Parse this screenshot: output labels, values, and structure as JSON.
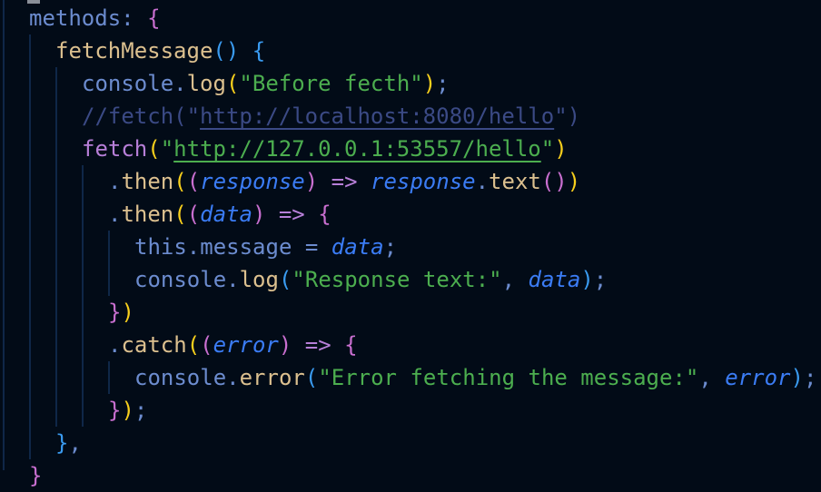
{
  "colors": {
    "background": "#020b17",
    "identifier": "#6c8ccf",
    "function": "#dcc08f",
    "string": "#4cae4f",
    "keyword": "#b77fd8",
    "bracket_yellow": "#f7cf1c",
    "bracket_pink": "#c96fd0",
    "bracket_blue": "#3a9bf0",
    "parameter": "#3b7cf5",
    "comment": "#3b4a85"
  },
  "lines": [
    {
      "indent": 2,
      "tokens": [
        {
          "t": "methods",
          "k": "ident"
        },
        {
          "t": ": ",
          "k": "punct"
        },
        {
          "t": "{",
          "k": "p2"
        }
      ]
    },
    {
      "indent": 4,
      "tokens": [
        {
          "t": "fetchMessage",
          "k": "fn"
        },
        {
          "t": "()",
          "k": "p3"
        },
        {
          "t": " ",
          "k": "punct"
        },
        {
          "t": "{",
          "k": "p3"
        }
      ]
    },
    {
      "indent": 6,
      "tokens": [
        {
          "t": "console",
          "k": "ident"
        },
        {
          "t": ".",
          "k": "punct"
        },
        {
          "t": "log",
          "k": "fn"
        },
        {
          "t": "(",
          "k": "p1"
        },
        {
          "t": "\"Before fecth\"",
          "k": "str"
        },
        {
          "t": ")",
          "k": "p1"
        },
        {
          "t": ";",
          "k": "punct"
        }
      ]
    },
    {
      "indent": 6,
      "tokens": [
        {
          "t": "//fetch(\"",
          "k": "comment"
        },
        {
          "t": "http://localhost:8080/hello",
          "k": "comment ul"
        },
        {
          "t": "\")",
          "k": "comment"
        }
      ]
    },
    {
      "indent": 6,
      "tokens": [
        {
          "t": "fetch",
          "k": "kw"
        },
        {
          "t": "(",
          "k": "p1"
        },
        {
          "t": "\"",
          "k": "str"
        },
        {
          "t": "http://127.0.0.1:53557/hello",
          "k": "str ul"
        },
        {
          "t": "\"",
          "k": "str"
        },
        {
          "t": ")",
          "k": "p1"
        }
      ]
    },
    {
      "indent": 8,
      "tokens": [
        {
          "t": ".",
          "k": "punct"
        },
        {
          "t": "then",
          "k": "fn"
        },
        {
          "t": "(",
          "k": "p1"
        },
        {
          "t": "(",
          "k": "p2"
        },
        {
          "t": "response",
          "k": "param"
        },
        {
          "t": ")",
          "k": "p2"
        },
        {
          "t": " => ",
          "k": "kw"
        },
        {
          "t": "response",
          "k": "param"
        },
        {
          "t": ".",
          "k": "punct"
        },
        {
          "t": "text",
          "k": "fn"
        },
        {
          "t": "()",
          "k": "p2"
        },
        {
          "t": ")",
          "k": "p1"
        }
      ]
    },
    {
      "indent": 8,
      "tokens": [
        {
          "t": ".",
          "k": "punct"
        },
        {
          "t": "then",
          "k": "fn"
        },
        {
          "t": "(",
          "k": "p1"
        },
        {
          "t": "(",
          "k": "p2"
        },
        {
          "t": "data",
          "k": "param"
        },
        {
          "t": ")",
          "k": "p2"
        },
        {
          "t": " => ",
          "k": "kw"
        },
        {
          "t": "{",
          "k": "p2"
        }
      ]
    },
    {
      "indent": 10,
      "tokens": [
        {
          "t": "this",
          "k": "ident"
        },
        {
          "t": ".",
          "k": "punct"
        },
        {
          "t": "message",
          "k": "ident"
        },
        {
          "t": " = ",
          "k": "punct"
        },
        {
          "t": "data",
          "k": "param"
        },
        {
          "t": ";",
          "k": "punct"
        }
      ]
    },
    {
      "indent": 10,
      "tokens": [
        {
          "t": "console",
          "k": "ident"
        },
        {
          "t": ".",
          "k": "punct"
        },
        {
          "t": "log",
          "k": "fn"
        },
        {
          "t": "(",
          "k": "p3"
        },
        {
          "t": "\"Response text:\"",
          "k": "str"
        },
        {
          "t": ", ",
          "k": "punct"
        },
        {
          "t": "data",
          "k": "param"
        },
        {
          "t": ")",
          "k": "p3"
        },
        {
          "t": ";",
          "k": "punct"
        }
      ]
    },
    {
      "indent": 8,
      "tokens": [
        {
          "t": "}",
          "k": "p2"
        },
        {
          "t": ")",
          "k": "p1"
        }
      ]
    },
    {
      "indent": 8,
      "tokens": [
        {
          "t": ".",
          "k": "punct"
        },
        {
          "t": "catch",
          "k": "fn"
        },
        {
          "t": "(",
          "k": "p1"
        },
        {
          "t": "(",
          "k": "p2"
        },
        {
          "t": "error",
          "k": "param"
        },
        {
          "t": ")",
          "k": "p2"
        },
        {
          "t": " => ",
          "k": "kw"
        },
        {
          "t": "{",
          "k": "p2"
        }
      ]
    },
    {
      "indent": 10,
      "tokens": [
        {
          "t": "console",
          "k": "ident"
        },
        {
          "t": ".",
          "k": "punct"
        },
        {
          "t": "error",
          "k": "fn"
        },
        {
          "t": "(",
          "k": "p3"
        },
        {
          "t": "\"Error fetching the message:\"",
          "k": "str"
        },
        {
          "t": ", ",
          "k": "punct"
        },
        {
          "t": "error",
          "k": "param"
        },
        {
          "t": ")",
          "k": "p3"
        },
        {
          "t": ";",
          "k": "punct"
        }
      ]
    },
    {
      "indent": 8,
      "tokens": [
        {
          "t": "}",
          "k": "p2"
        },
        {
          "t": ")",
          "k": "p1"
        },
        {
          "t": ";",
          "k": "punct"
        }
      ]
    },
    {
      "indent": 4,
      "tokens": [
        {
          "t": "}",
          "k": "p3"
        },
        {
          "t": ",",
          "k": "punct"
        }
      ]
    },
    {
      "indent": 2,
      "tokens": [
        {
          "t": "}",
          "k": "p2"
        }
      ]
    }
  ]
}
